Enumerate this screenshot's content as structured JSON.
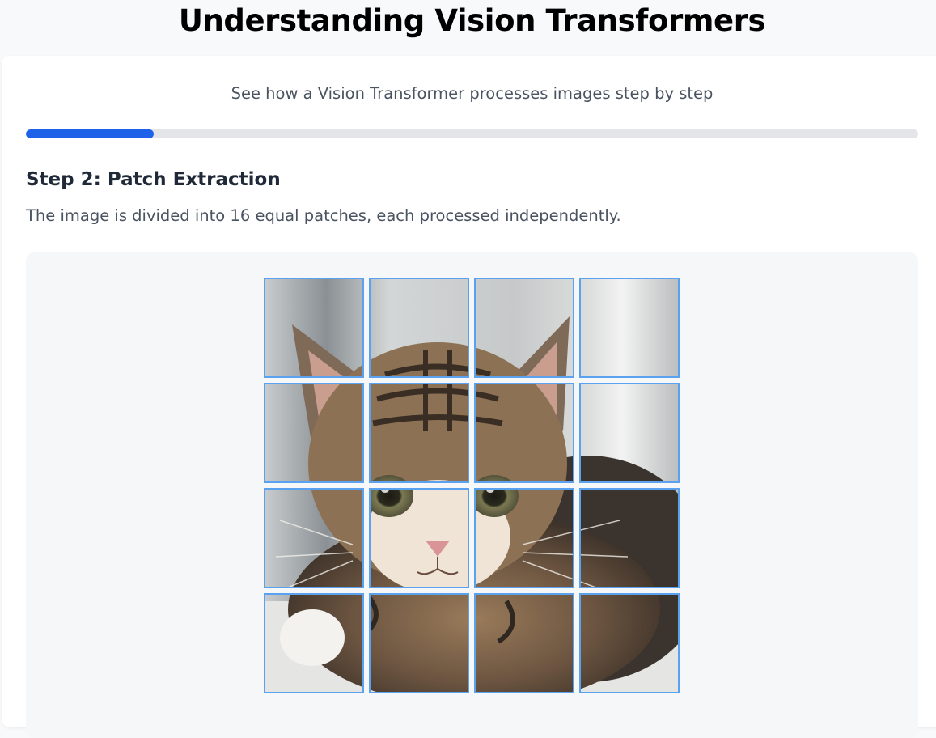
{
  "header": {
    "title": "Understanding Vision Transformers"
  },
  "intro": {
    "subtitle": "See how a Vision Transformer processes images step by step"
  },
  "progress": {
    "current_step": 2,
    "fraction": 0.143,
    "fill_color": "#1e62ea",
    "track_color": "#e3e5e9"
  },
  "step": {
    "heading": "Step 2: Patch Extraction",
    "description": "The image is divided into 16 equal patches, each processed independently."
  },
  "patch_grid": {
    "rows": 4,
    "cols": 4,
    "patch_count": 16,
    "border_color": "#5aa2f0",
    "image_subject": "tabby-kitten-photo"
  }
}
